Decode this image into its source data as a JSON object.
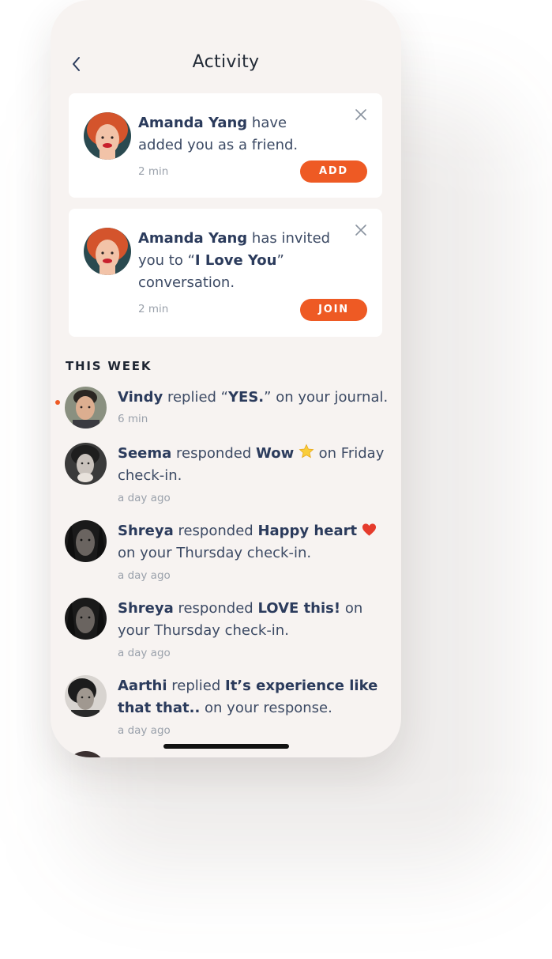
{
  "header": {
    "title": "Activity",
    "back_icon": "chevron-left-icon"
  },
  "colors": {
    "accent": "#ee5a24",
    "background": "#f7f3f1",
    "card": "#ffffff",
    "name_text": "#2b3b5c"
  },
  "cards": [
    {
      "name": "Amanda Yang",
      "text_before": " have added you as a friend.",
      "time": "2 min",
      "button": "ADD"
    },
    {
      "name": "Amanda Yang",
      "text_before": " has invited you to “",
      "highlight": "I Love You",
      "text_after": "” conversation.",
      "time": "2 min",
      "button": "JOIN"
    }
  ],
  "section_title": "THIS WEEK",
  "activities": [
    {
      "name": "Vindy",
      "verb": " replied “",
      "highlight": "YES.",
      "rest": "” on your journal.",
      "time": "6 min",
      "unread": true
    },
    {
      "name": "Seema",
      "verb": " responded ",
      "highlight": "Wow",
      "emoji": "star-emoji",
      "rest": " on Friday check-in.",
      "time": "a day ago"
    },
    {
      "name": "Shreya",
      "verb": " responded ",
      "highlight": "Happy heart",
      "emoji": "heart-emoji",
      "rest": " on your Thursday check-in.",
      "time": "a day ago"
    },
    {
      "name": "Shreya",
      "verb": " responded ",
      "highlight": "LOVE this!",
      "rest": " on your Thursday check-in.",
      "time": "a day ago"
    },
    {
      "name": "Aarthi",
      "verb": " replied ",
      "highlight": "It’s experience like that that..",
      "rest": " on your response.",
      "time": "a day ago"
    }
  ]
}
